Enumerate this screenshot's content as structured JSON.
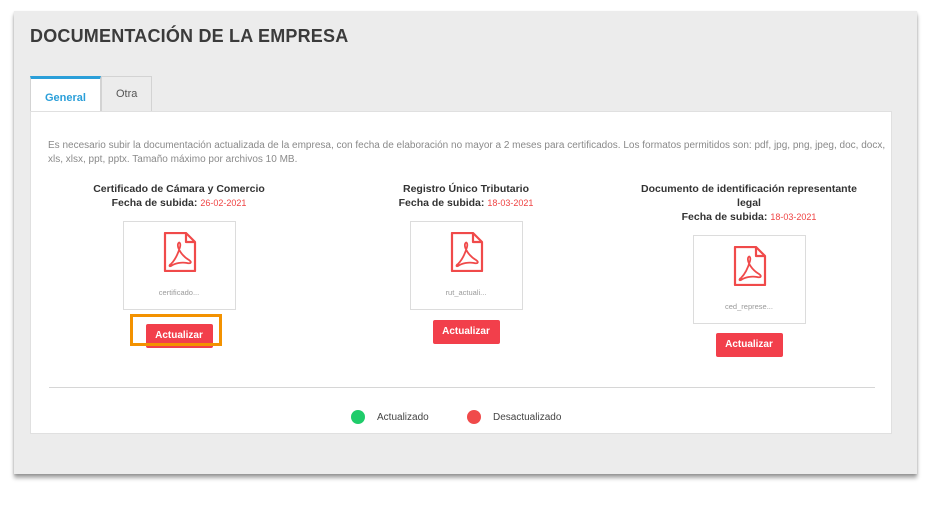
{
  "panel": {
    "title": "DOCUMENTACIÓN DE LA EMPRESA"
  },
  "tabs": [
    {
      "label": "General",
      "active": true
    },
    {
      "label": "Otra",
      "active": false
    }
  ],
  "notice": "Es necesario subir la documentación actualizada de la empresa, con fecha de elaboración no mayor a 2 meses para certificados. Los formatos permitidos son: pdf, jpg, png, jpeg, doc, docx, xls, xlsx, ppt, pptx. Tamaño máximo por archivos 10 MB.",
  "documents": [
    {
      "title": "Certificado de Cámara y Comercio",
      "date_label": "Fecha de subida:",
      "date": "26-02-2021",
      "file_name": "certificado...",
      "button_label": "Actualizar",
      "icon": "pdf-icon"
    },
    {
      "title": "Registro Único Tributario",
      "date_label": "Fecha de subida:",
      "date": "18-03-2021",
      "file_name": "rut_actuali...",
      "button_label": "Actualizar",
      "icon": "pdf-icon"
    },
    {
      "title": "Documento de identificación representante legal",
      "date_label": "Fecha de subida:",
      "date": "18-03-2021",
      "file_name": "ced_represe...",
      "button_label": "Actualizar",
      "icon": "pdf-icon"
    }
  ],
  "legend": [
    {
      "label": "Actualizado",
      "color": "#1fcc6a"
    },
    {
      "label": "Desactualizado",
      "color": "#f04a4a"
    }
  ],
  "colors": {
    "accent": "#2b9fd9",
    "button": "#f23f4b",
    "date": "#ef4444",
    "highlight": "#f39200"
  }
}
